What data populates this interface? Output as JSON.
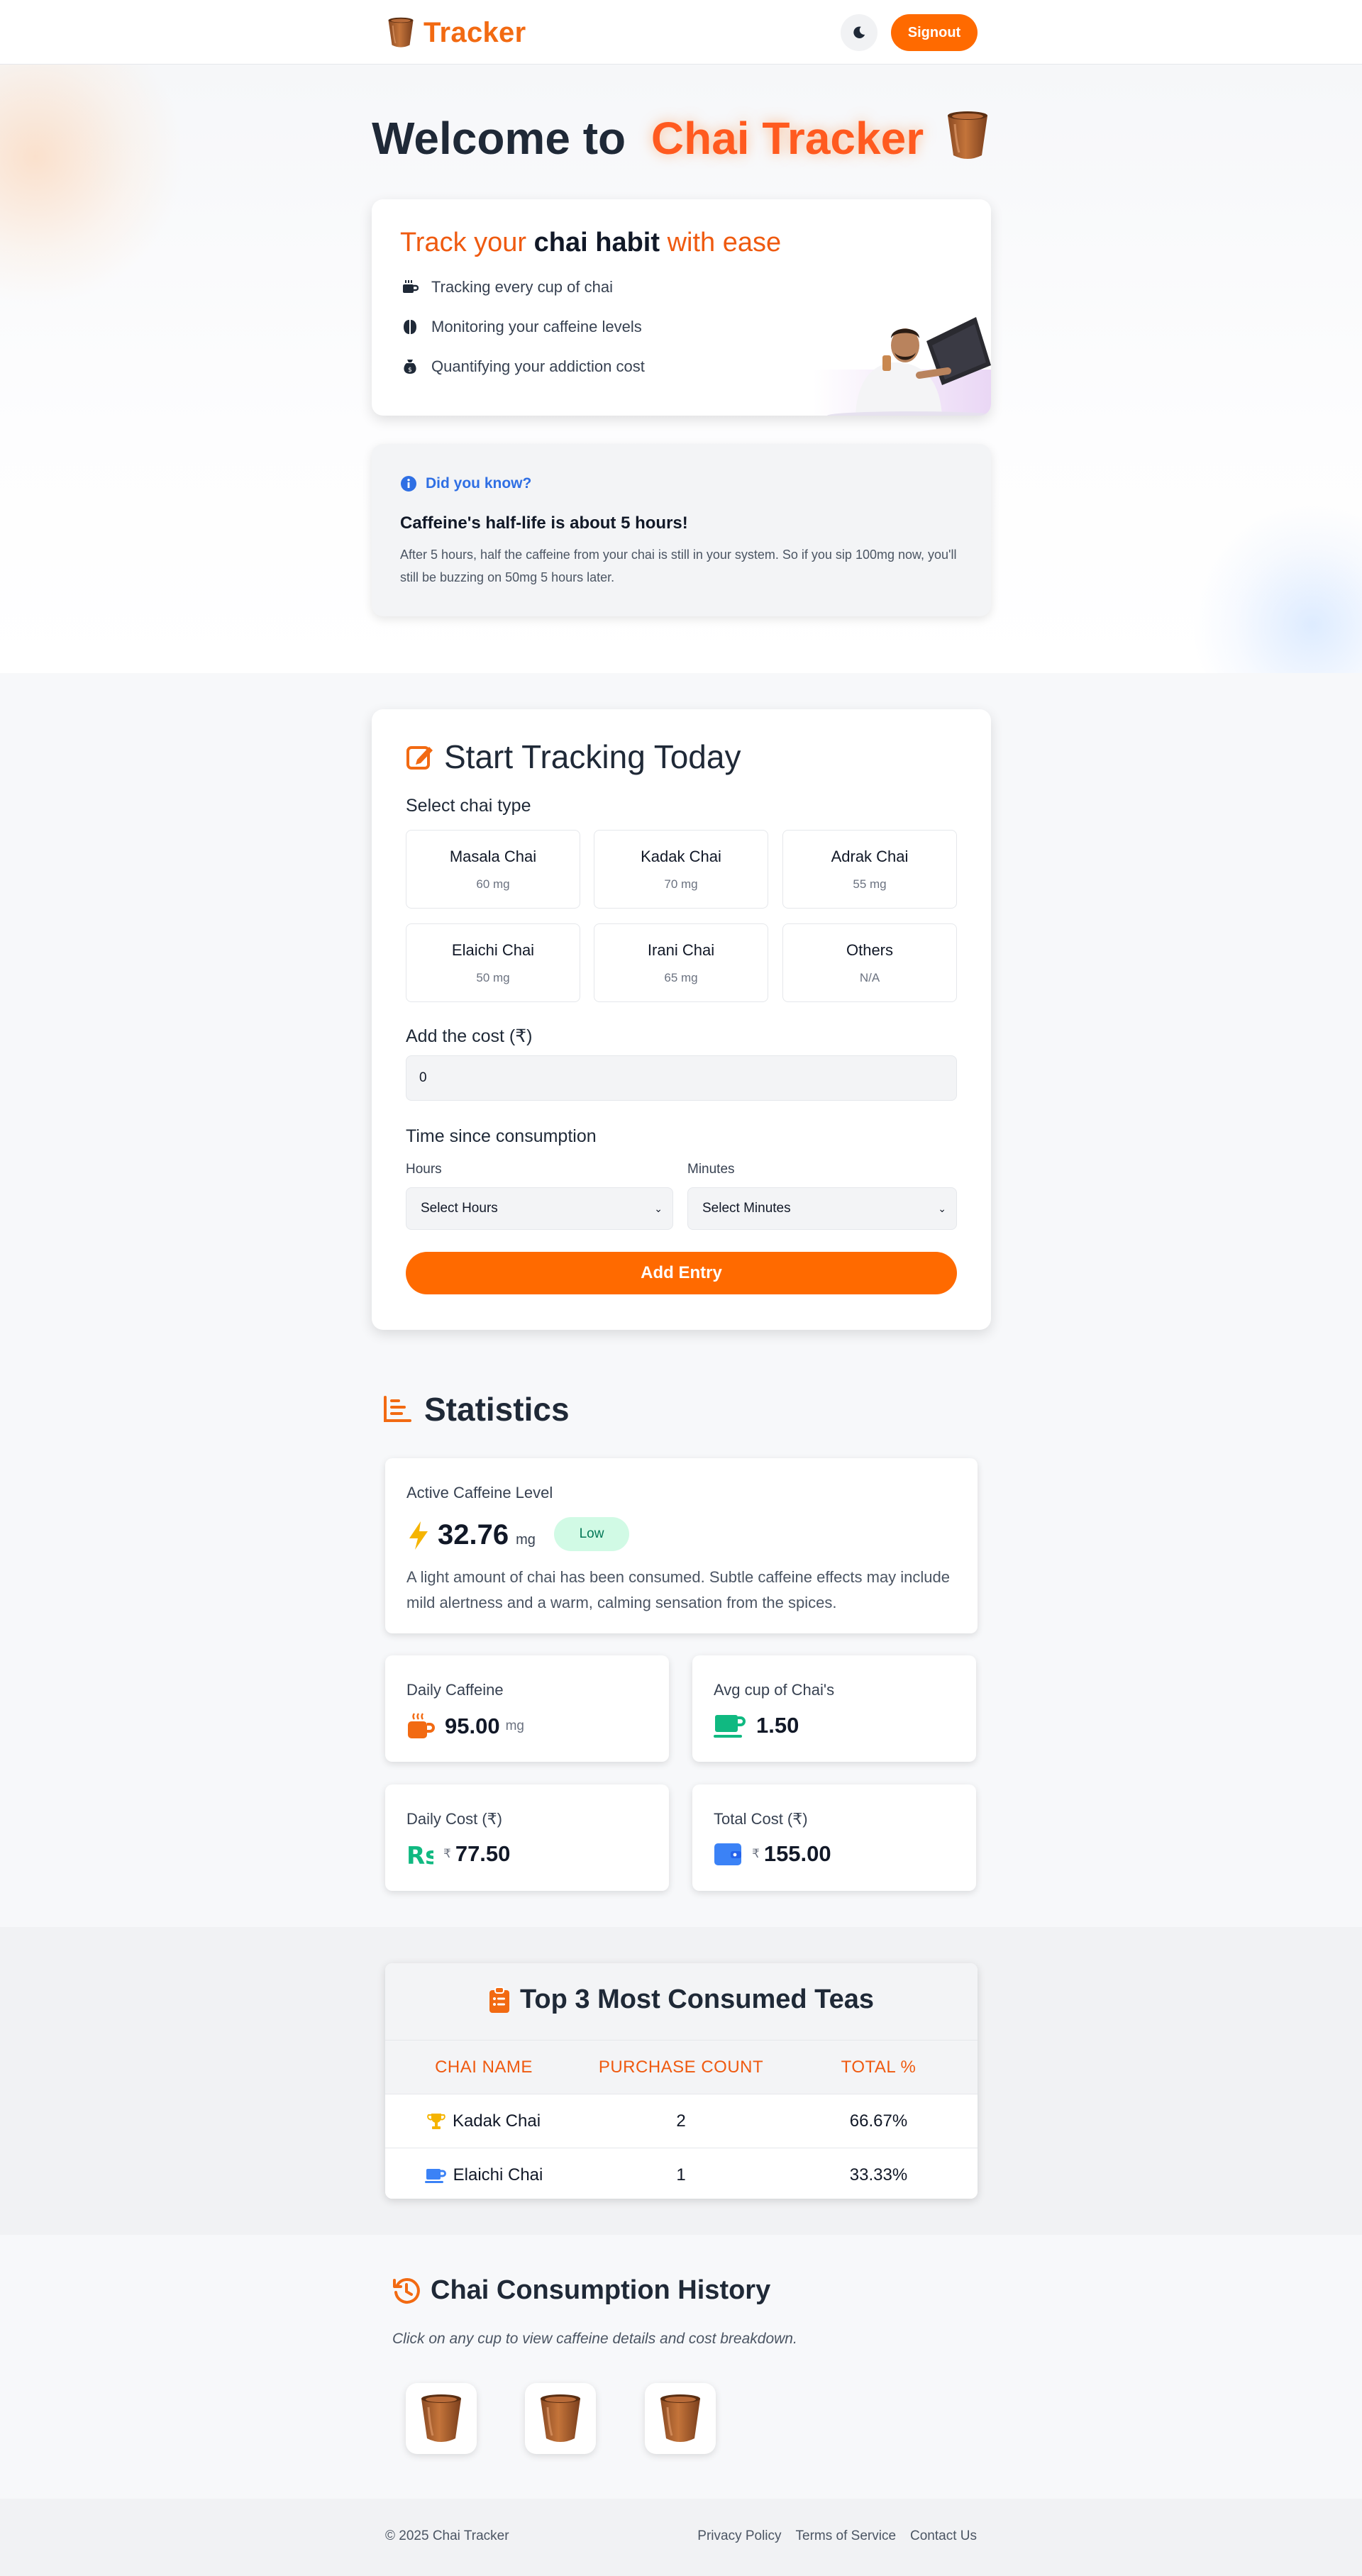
{
  "nav": {
    "brand": "Tracker",
    "signout_label": "Signout",
    "theme_icon": "moon-icon"
  },
  "hero": {
    "title_prefix": "Welcome to",
    "title_accent": "Chai Tracker",
    "feature_heading": {
      "part1": "Track your",
      "bold": "chai habit",
      "part2": "with ease"
    },
    "features": [
      {
        "icon": "mug-icon",
        "label": "Tracking every cup of chai"
      },
      {
        "icon": "brain-icon",
        "label": "Monitoring your caffeine levels"
      },
      {
        "icon": "money-bag-icon",
        "label": "Quantifying your addiction cost"
      }
    ]
  },
  "fact": {
    "heading": "Did you know?",
    "title": "Caffeine's half-life is about 5 hours!",
    "body": "After 5 hours, half the caffeine from your chai is still in your system. So if you sip 100mg now, you'll still be buzzing on 50mg 5 hours later."
  },
  "tracking": {
    "title": "Start Tracking Today",
    "select_label": "Select chai type",
    "chai_types": [
      {
        "name": "Masala Chai",
        "mg": "60 mg"
      },
      {
        "name": "Kadak Chai",
        "mg": "70 mg"
      },
      {
        "name": "Adrak Chai",
        "mg": "55 mg"
      },
      {
        "name": "Elaichi Chai",
        "mg": "50 mg"
      },
      {
        "name": "Irani Chai",
        "mg": "65 mg"
      },
      {
        "name": "Others",
        "mg": "N/A"
      }
    ],
    "cost_label": "Add the cost (₹)",
    "cost_value": "0",
    "time_label": "Time since consumption",
    "hours_label": "Hours",
    "minutes_label": "Minutes",
    "hours_value": "Select Hours",
    "minutes_value": "Select Minutes",
    "add_label": "Add Entry"
  },
  "stats": {
    "title": "Statistics",
    "active": {
      "label": "Active Caffeine Level",
      "value": "32.76",
      "unit": "mg",
      "badge": "Low",
      "description": "A light amount of chai has been consumed. Subtle caffeine effects may include mild alertness and a warm, calming sensation from the spices."
    },
    "daily_caffeine": {
      "label": "Daily Caffeine",
      "value": "95.00",
      "unit": "mg"
    },
    "avg_cup": {
      "label": "Avg cup of Chai's",
      "value": "1.50"
    },
    "daily_cost": {
      "label": "Daily Cost (₹)",
      "currency": "₹",
      "value": "77.50"
    },
    "total_cost": {
      "label": "Total Cost (₹)",
      "currency": "₹",
      "value": "155.00"
    }
  },
  "top": {
    "title": "Top 3 Most Consumed Teas",
    "columns": [
      "CHAI NAME",
      "PURCHASE COUNT",
      "TOTAL %"
    ],
    "rows": [
      {
        "icon": "trophy-icon",
        "name": "Kadak Chai",
        "count": "2",
        "pct": "66.67%"
      },
      {
        "icon": "mug-icon",
        "name": "Elaichi Chai",
        "count": "1",
        "pct": "33.33%"
      }
    ]
  },
  "history": {
    "title": "Chai Consumption History",
    "subtitle": "Click on any cup to view caffeine details and cost breakdown.",
    "cups": [
      "kulhad-cup-icon",
      "kulhad-cup-icon",
      "kulhad-cup-icon"
    ]
  },
  "footer": {
    "copyright": "© 2025 Chai Tracker",
    "links": [
      "Privacy Policy",
      "Terms of Service",
      "Contact Us"
    ]
  },
  "colors": {
    "accent": "#ff6a00",
    "accent_text": "#ef5a10",
    "info": "#2f6fe4",
    "low_badge_bg": "#d1fae5",
    "low_badge_text": "#047857"
  }
}
